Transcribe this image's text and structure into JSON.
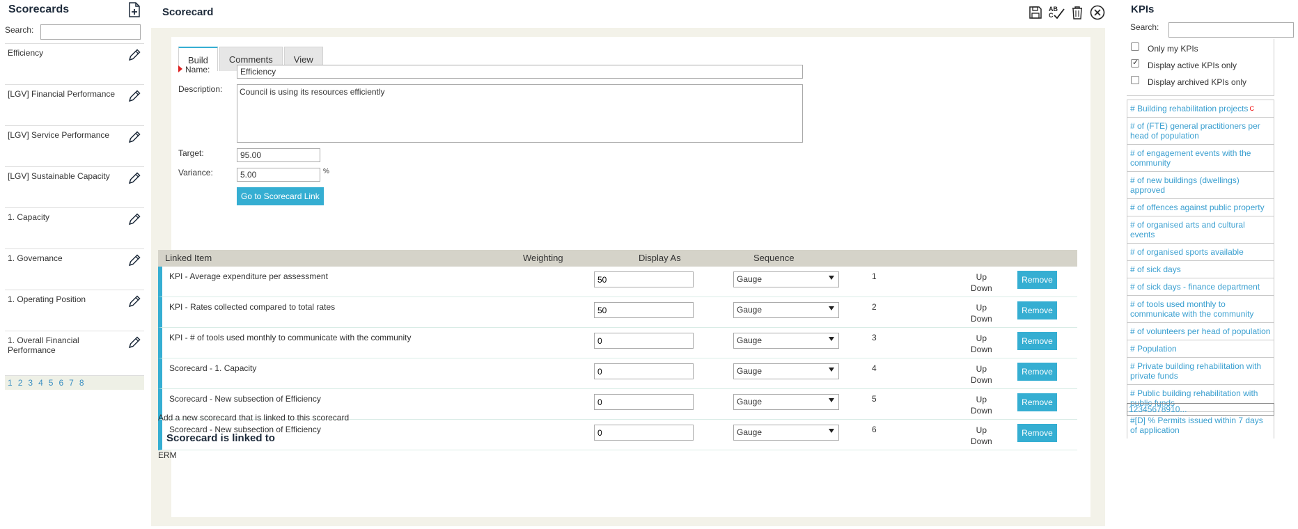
{
  "left": {
    "title": "Scorecards",
    "search_label": "Search:",
    "search_value": "",
    "items": [
      {
        "label": "Efficiency"
      },
      {
        "label": "[LGV] Financial Performance"
      },
      {
        "label": "[LGV] Service Performance"
      },
      {
        "label": "[LGV] Sustainable Capacity"
      },
      {
        "label": "1. Capacity"
      },
      {
        "label": "1. Governance"
      },
      {
        "label": "1. Operating Position"
      },
      {
        "label": "1. Overall Financial Performance"
      }
    ],
    "pages": [
      "1",
      "2",
      "3",
      "4",
      "5",
      "6",
      "7",
      "8"
    ]
  },
  "main": {
    "title": "Scorecard",
    "toolbar": {
      "spellcheck_text": "AB"
    },
    "tabs": [
      {
        "label": "Build",
        "active": true
      },
      {
        "label": "Comments",
        "active": false
      },
      {
        "label": "View",
        "active": false
      }
    ],
    "form": {
      "name_label": "Name:",
      "name_value": "Efficiency",
      "description_label": "Description:",
      "description_value": "Council is using its resources efficiently",
      "target_label": "Target:",
      "target_value": "95.00",
      "variance_label": "Variance:",
      "variance_value": "5.00",
      "variance_unit": "%",
      "link_button": "Go to Scorecard Link"
    },
    "table": {
      "headers": {
        "linked_item": "Linked Item",
        "weighting": "Weighting",
        "display_as": "Display As",
        "sequence": "Sequence"
      },
      "rows": [
        {
          "item": "KPI - Average expenditure per assessment",
          "weighting": "50",
          "display": "Gauge",
          "sequence": "1",
          "up": "Up",
          "down": "Down",
          "remove": "Remove"
        },
        {
          "item": "KPI - Rates collected compared to total rates",
          "weighting": "50",
          "display": "Gauge",
          "sequence": "2",
          "up": "Up",
          "down": "Down",
          "remove": "Remove"
        },
        {
          "item": "KPI - # of tools used monthly to communicate with the community",
          "weighting": "0",
          "display": "Gauge",
          "sequence": "3",
          "up": "Up",
          "down": "Down",
          "remove": "Remove"
        },
        {
          "item": "Scorecard - 1. Capacity",
          "weighting": "0",
          "display": "Gauge",
          "sequence": "4",
          "up": "Up",
          "down": "Down",
          "remove": "Remove"
        },
        {
          "item": "Scorecard - New subsection of Efficiency",
          "weighting": "0",
          "display": "Gauge",
          "sequence": "5",
          "up": "Up",
          "down": "Down",
          "remove": "Remove"
        },
        {
          "item": "Scorecard - New subsection of Efficiency",
          "weighting": "0",
          "display": "Gauge",
          "sequence": "6",
          "up": "Up",
          "down": "Down",
          "remove": "Remove"
        }
      ]
    },
    "add_new_text": "Add a new scorecard that is linked to this scorecard",
    "linked_heading": "Scorecard is linked to",
    "linked_value": "ERM"
  },
  "right": {
    "title": "KPIs",
    "search_label": "Search:",
    "search_value": "",
    "filters": [
      {
        "label": "Only my KPIs",
        "checked": false
      },
      {
        "label": "Display active KPIs only",
        "checked": true
      },
      {
        "label": "Display archived KPIs only",
        "checked": false
      }
    ],
    "kpis": [
      {
        "label": "# Building rehabilitation projects",
        "mark": "C"
      },
      {
        "label": "# of (FTE) general practitioners per head of population",
        "mark": ""
      },
      {
        "label": "# of engagement events with the community",
        "mark": ""
      },
      {
        "label": "# of new buildings (dwellings) approved",
        "mark": ""
      },
      {
        "label": "# of offences against public property",
        "mark": ""
      },
      {
        "label": "# of organised arts and cultural events",
        "mark": ""
      },
      {
        "label": "# of organised sports available",
        "mark": ""
      },
      {
        "label": "# of sick days",
        "mark": ""
      },
      {
        "label": "# of sick days - finance department",
        "mark": ""
      },
      {
        "label": "# of tools used monthly to communicate with the community",
        "mark": ""
      },
      {
        "label": "# of volunteers per head of population",
        "mark": ""
      },
      {
        "label": "# Population",
        "mark": ""
      },
      {
        "label": "# Private building rehabilitation with private funds",
        "mark": ""
      },
      {
        "label": "# Public building rehabilitation with public funds",
        "mark": ""
      },
      {
        "label": "#[D] % Permits issued within 7 days of application",
        "mark": ""
      }
    ],
    "pager_text": "12345678910..."
  },
  "colors": {
    "accent": "#35aed2",
    "link": "#3a9fd0",
    "header_bg": "#d5d3c9",
    "frame_bg": "#f3f2e9",
    "required": "#dd2222"
  }
}
